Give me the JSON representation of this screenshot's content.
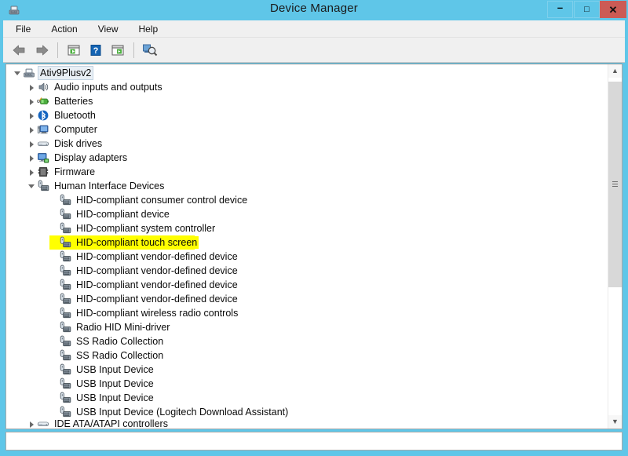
{
  "window": {
    "title": "Device Manager",
    "app_icon": "device-manager-icon",
    "accent_color": "#5fc6e8",
    "close_color": "#cc5b55",
    "controls": {
      "minimize": "–",
      "maximize": "□",
      "close": "✕",
      "minimize_name": "minimize-button",
      "maximize_name": "maximize-button",
      "close_name": "close-button"
    }
  },
  "menubar": {
    "items": [
      {
        "label": "File"
      },
      {
        "label": "Action"
      },
      {
        "label": "View"
      },
      {
        "label": "Help"
      }
    ]
  },
  "toolbar": {
    "buttons": [
      {
        "name": "back-arrow-icon",
        "icon": "arrow-left"
      },
      {
        "name": "forward-arrow-icon",
        "icon": "arrow-right"
      },
      {
        "name": "separator",
        "icon": "separator"
      },
      {
        "name": "properties-icon",
        "icon": "window-green"
      },
      {
        "name": "help-icon",
        "icon": "question-blue"
      },
      {
        "name": "update-driver-icon",
        "icon": "window-play"
      },
      {
        "name": "scan-hardware-icon",
        "icon": "scan-magnifier"
      }
    ]
  },
  "tree": {
    "nodes": [
      {
        "label": "Ativ9Plusv2",
        "indent": 0,
        "expander": "expanded",
        "icon": "computer-root-icon",
        "state": "selected"
      },
      {
        "label": "Audio inputs and outputs",
        "indent": 1,
        "expander": "collapsed",
        "icon": "speaker-icon",
        "state": "normal"
      },
      {
        "label": "Batteries",
        "indent": 1,
        "expander": "collapsed",
        "icon": "battery-icon",
        "state": "normal"
      },
      {
        "label": "Bluetooth",
        "indent": 1,
        "expander": "collapsed",
        "icon": "bluetooth-icon",
        "state": "normal"
      },
      {
        "label": "Computer",
        "indent": 1,
        "expander": "collapsed",
        "icon": "computer-icon",
        "state": "normal"
      },
      {
        "label": "Disk drives",
        "indent": 1,
        "expander": "collapsed",
        "icon": "disk-drive-icon",
        "state": "normal"
      },
      {
        "label": "Display adapters",
        "indent": 1,
        "expander": "collapsed",
        "icon": "display-adapter-icon",
        "state": "normal"
      },
      {
        "label": "Firmware",
        "indent": 1,
        "expander": "collapsed",
        "icon": "firmware-icon",
        "state": "normal"
      },
      {
        "label": "Human Interface Devices",
        "indent": 1,
        "expander": "expanded",
        "icon": "hid-icon",
        "state": "normal"
      },
      {
        "label": "HID-compliant consumer control device",
        "indent": 2,
        "expander": "none",
        "icon": "hid-icon",
        "state": "normal"
      },
      {
        "label": "HID-compliant device",
        "indent": 2,
        "expander": "none",
        "icon": "hid-icon",
        "state": "normal"
      },
      {
        "label": "HID-compliant system controller",
        "indent": 2,
        "expander": "none",
        "icon": "hid-icon",
        "state": "normal"
      },
      {
        "label": "HID-compliant touch screen",
        "indent": 2,
        "expander": "none",
        "icon": "hid-icon",
        "state": "highlight"
      },
      {
        "label": "HID-compliant vendor-defined device",
        "indent": 2,
        "expander": "none",
        "icon": "hid-icon",
        "state": "normal"
      },
      {
        "label": "HID-compliant vendor-defined device",
        "indent": 2,
        "expander": "none",
        "icon": "hid-icon",
        "state": "normal"
      },
      {
        "label": "HID-compliant vendor-defined device",
        "indent": 2,
        "expander": "none",
        "icon": "hid-icon",
        "state": "normal"
      },
      {
        "label": "HID-compliant vendor-defined device",
        "indent": 2,
        "expander": "none",
        "icon": "hid-icon",
        "state": "normal"
      },
      {
        "label": "HID-compliant wireless radio controls",
        "indent": 2,
        "expander": "none",
        "icon": "hid-icon",
        "state": "normal"
      },
      {
        "label": "Radio HID Mini-driver",
        "indent": 2,
        "expander": "none",
        "icon": "hid-icon",
        "state": "normal"
      },
      {
        "label": "SS Radio Collection",
        "indent": 2,
        "expander": "none",
        "icon": "hid-icon",
        "state": "normal"
      },
      {
        "label": "SS Radio Collection",
        "indent": 2,
        "expander": "none",
        "icon": "hid-icon",
        "state": "normal"
      },
      {
        "label": "USB Input Device",
        "indent": 2,
        "expander": "none",
        "icon": "hid-icon",
        "state": "normal"
      },
      {
        "label": "USB Input Device",
        "indent": 2,
        "expander": "none",
        "icon": "hid-icon",
        "state": "normal"
      },
      {
        "label": "USB Input Device",
        "indent": 2,
        "expander": "none",
        "icon": "hid-icon",
        "state": "normal"
      },
      {
        "label": "USB Input Device (Logitech Download Assistant)",
        "indent": 2,
        "expander": "none",
        "icon": "hid-icon",
        "state": "normal"
      },
      {
        "label": "IDE ATA/ATAPI controllers",
        "indent": 1,
        "expander": "collapsed",
        "icon": "disk-drive-icon",
        "state": "clipped"
      }
    ],
    "highlight_color": "#ffff00",
    "selection_color": "#e9eff5"
  },
  "scrollbar": {
    "up_glyph": "ⱏ",
    "down_glyph": "ⱟ",
    "up_name": "scroll-up-button",
    "down_name": "scroll-down-button",
    "thumb_name": "scroll-thumb"
  },
  "statusbar": {
    "text": ""
  }
}
